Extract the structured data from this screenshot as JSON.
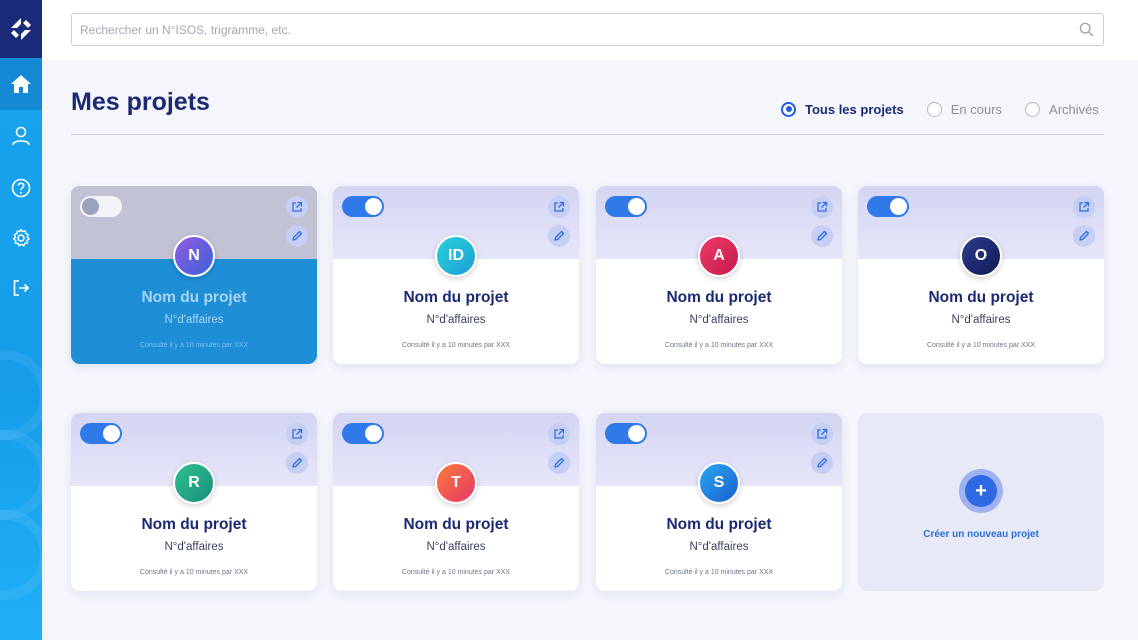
{
  "search": {
    "placeholder": "Rechercher un N°ISOS, trigramme, etc."
  },
  "page": {
    "title": "Mes projets"
  },
  "filters": [
    {
      "label": "Tous les projets",
      "checked": true
    },
    {
      "label": "En cours",
      "checked": false
    },
    {
      "label": "Archivés",
      "checked": false
    }
  ],
  "projects": [
    {
      "initial": "N",
      "name": "Nom du projet",
      "number": "N°d'affaires",
      "meta": "Consulté il y a 10 minutes par XXX",
      "active": false,
      "color_a": "#8f5ee0",
      "color_b": "#3f5fd8"
    },
    {
      "initial": "ID",
      "name": "Nom du projet",
      "number": "N°d'affaires",
      "meta": "Consulté il y a 10 minutes par XXX",
      "active": true,
      "color_a": "#2ad0d6",
      "color_b": "#1d9fd8"
    },
    {
      "initial": "A",
      "name": "Nom du projet",
      "number": "N°d'affaires",
      "meta": "Consulté il y a 10 minutes par XXX",
      "active": true,
      "color_a": "#f23a6b",
      "color_b": "#c21a4a"
    },
    {
      "initial": "O",
      "name": "Nom du projet",
      "number": "N°d'affaires",
      "meta": "Consulté il y a 10 minutes par XXX",
      "active": true,
      "color_a": "#2d3c8e",
      "color_b": "#101a55"
    },
    {
      "initial": "R",
      "name": "Nom du projet",
      "number": "N°d'affaires",
      "meta": "Consulté il y a 10 minutes par XXX",
      "active": true,
      "color_a": "#2fc08b",
      "color_b": "#1a8f80"
    },
    {
      "initial": "T",
      "name": "Nom du projet",
      "number": "N°d'affaires",
      "meta": "Consulté il y a 10 minutes par XXX",
      "active": true,
      "color_a": "#f97b3a",
      "color_b": "#e8376a"
    },
    {
      "initial": "S",
      "name": "Nom du projet",
      "number": "N°d'affaires",
      "meta": "Consulté il y a 10 minutes par XXX",
      "active": true,
      "color_a": "#2aa7f0",
      "color_b": "#1b5fcf"
    }
  ],
  "new_project": {
    "label": "Créer un nouveau projet",
    "plus": "+"
  },
  "nav": {
    "items": [
      {
        "icon": "home-icon",
        "active": true
      },
      {
        "icon": "user-icon",
        "active": false
      },
      {
        "icon": "help-icon",
        "active": false
      },
      {
        "icon": "gear-icon",
        "active": false
      },
      {
        "icon": "logout-icon",
        "active": false
      }
    ]
  },
  "colors": {
    "primary": "#1b2a73",
    "accent": "#2f7ae8",
    "sidebar": "#18a6f1",
    "logo_bg": "#1c2a7a"
  }
}
